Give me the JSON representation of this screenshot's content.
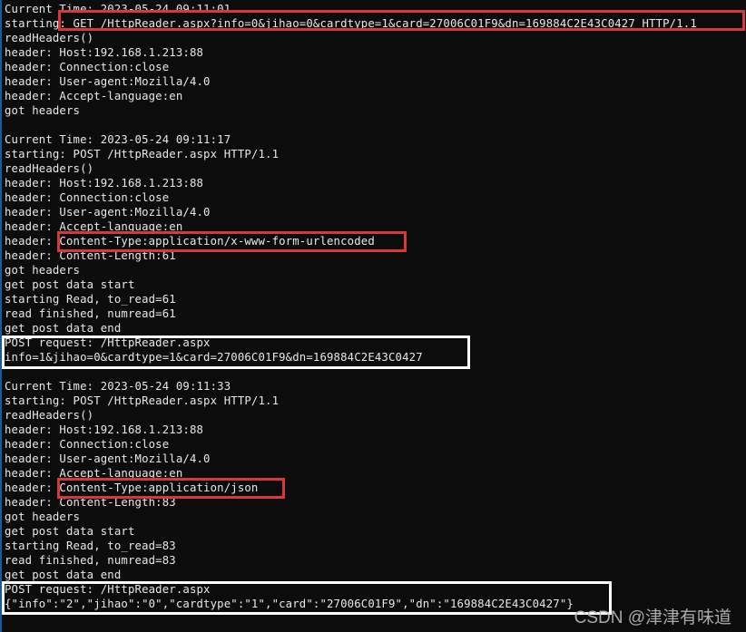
{
  "console": {
    "lines": [
      "Current Time: 2023-05-24 09:11:01",
      "starting: GET /HttpReader.aspx?info=0&jihao=0&cardtype=1&card=27006C01F9&dn=169884C2E43C0427 HTTP/1.1",
      "readHeaders()",
      "header: Host:192.168.1.213:88",
      "header: Connection:close",
      "header: User-agent:Mozilla/4.0",
      "header: Accept-language:en",
      "got headers",
      "",
      "Current Time: 2023-05-24 09:11:17",
      "starting: POST /HttpReader.aspx HTTP/1.1",
      "readHeaders()",
      "header: Host:192.168.1.213:88",
      "header: Connection:close",
      "header: User-agent:Mozilla/4.0",
      "header: Accept-language:en",
      "header: Content-Type:application/x-www-form-urlencoded",
      "header: Content-Length:61",
      "got headers",
      "get post data start",
      "starting Read, to_read=61",
      "read finished, numread=61",
      "get post data end",
      "POST request: /HttpReader.aspx",
      "info=1&jihao=0&cardtype=1&card=27006C01F9&dn=169884C2E43C0427",
      "",
      "Current Time: 2023-05-24 09:11:33",
      "starting: POST /HttpReader.aspx HTTP/1.1",
      "readHeaders()",
      "header: Host:192.168.1.213:88",
      "header: Connection:close",
      "header: User-agent:Mozilla/4.0",
      "header: Accept-language:en",
      "header: Content-Type:application/json",
      "header: Content-Length:83",
      "got headers",
      "get post data start",
      "starting Read, to_read=83",
      "read finished, numread=83",
      "get post data end",
      "POST request: /HttpReader.aspx",
      "{\"info\":\"2\",\"jihao\":\"0\",\"cardtype\":\"1\",\"card\":\"27006C01F9\",\"dn\":\"169884C2E43C0427\"}"
    ]
  },
  "highlights": {
    "red_color": "#d9383a",
    "white_color": "#ffffff",
    "get_request": "GET request line",
    "form_content_type": "Content-Type form-urlencoded",
    "form_post_body": "Form POST body",
    "json_content_type": "Content-Type json",
    "json_post_body": "JSON POST body"
  },
  "watermark": "CSDN @津津有味道"
}
